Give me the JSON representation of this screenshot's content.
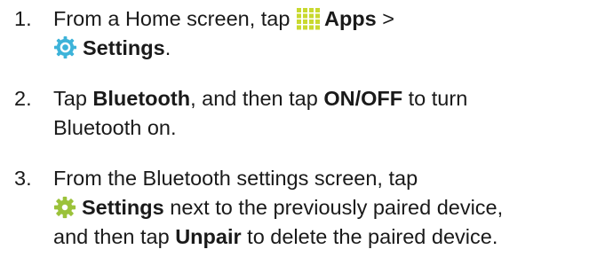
{
  "steps": [
    {
      "number": "1.",
      "lines": [
        {
          "a": "From a Home screen, tap ",
          "b": "Apps",
          "c": " >"
        },
        {
          "b": "Settings",
          "c": "."
        }
      ],
      "icons": [
        "apps-grid-icon",
        "settings-icon"
      ],
      "colors": {
        "apps": "#c9d92f",
        "settings": "#3db3d9"
      }
    },
    {
      "number": "2.",
      "lines": [
        {
          "a": "Tap ",
          "b": "Bluetooth",
          "c": ", and then tap ",
          "d": "ON/OFF",
          "e": " to turn"
        },
        {
          "a": "Bluetooth on."
        }
      ]
    },
    {
      "number": "3.",
      "lines": [
        {
          "a": "From the Bluetooth settings screen, tap"
        },
        {
          "b": "Settings",
          "c": " next to the previously paired device,"
        },
        {
          "a": "and then tap ",
          "b": "Unpair",
          "c": " to delete the paired device."
        }
      ],
      "icons": [
        "gear-icon"
      ],
      "colors": {
        "gear": "#9bc23a"
      }
    }
  ]
}
